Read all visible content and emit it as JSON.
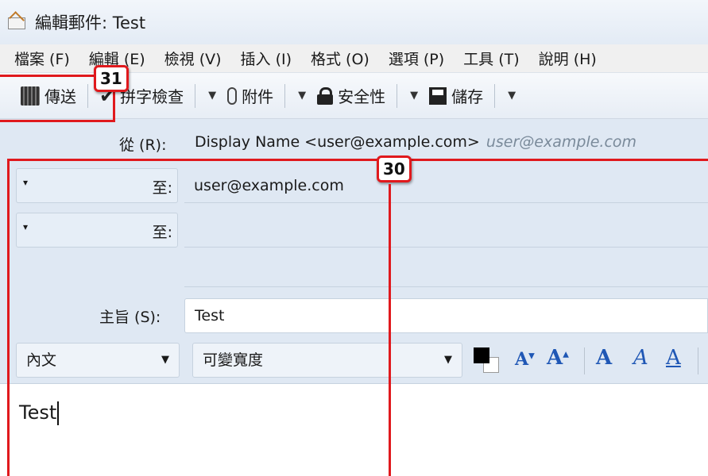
{
  "window": {
    "title": "編輯郵件: Test"
  },
  "menu": {
    "items": [
      "檔案 (F)",
      "編輯 (E)",
      "檢視 (V)",
      "插入 (I)",
      "格式 (O)",
      "選項 (P)",
      "工具 (T)",
      "說明 (H)"
    ]
  },
  "toolbar": {
    "send": "傳送",
    "spellcheck": "拼字檢查",
    "attach": "附件",
    "security": "安全性",
    "save": "儲存"
  },
  "from": {
    "label": "從 (R):",
    "value": "Display Name <user@example.com>",
    "hint": "user@example.com"
  },
  "recipients": [
    {
      "type": "至:",
      "value": "user@example.com"
    },
    {
      "type": "至:",
      "value": ""
    }
  ],
  "subject": {
    "label": "主旨 (S):",
    "value": "Test"
  },
  "format": {
    "paragraph": "內文",
    "font": "可變寬度"
  },
  "body": {
    "text": "Test"
  },
  "annotations": [
    {
      "label": "31"
    },
    {
      "label": "30"
    }
  ],
  "colors": {
    "highlight": "#e0191d",
    "header_bg": "#dfe8f3",
    "format_icon": "#1f57b5"
  }
}
